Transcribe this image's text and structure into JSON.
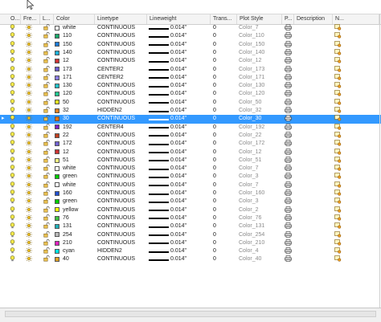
{
  "header": {
    "columns": [
      "O...",
      "Fre...",
      "L...",
      "Color",
      "Linetype",
      "Lineweight",
      "Trans...",
      "Plot Style",
      "P...",
      "Description",
      "N..."
    ]
  },
  "rows": [
    {
      "color_name": "white",
      "color_hex": "#ffffff",
      "linetype": "CONTINUOUS",
      "lineweight": "0.014\"",
      "trans": "0",
      "plot_style": "Color_7",
      "selected": false
    },
    {
      "color_name": "110",
      "color_hex": "#1aa86a",
      "linetype": "CONTINUOUS",
      "lineweight": "0.014\"",
      "trans": "0",
      "plot_style": "Color_110",
      "selected": false
    },
    {
      "color_name": "150",
      "color_hex": "#1a7ad6",
      "linetype": "CONTINUOUS",
      "lineweight": "0.014\"",
      "trans": "0",
      "plot_style": "Color_150",
      "selected": false
    },
    {
      "color_name": "140",
      "color_hex": "#1ab0d8",
      "linetype": "CONTINUOUS",
      "lineweight": "0.014\"",
      "trans": "0",
      "plot_style": "Color_140",
      "selected": false
    },
    {
      "color_name": "12",
      "color_hex": "#cc3333",
      "linetype": "CONTINUOUS",
      "lineweight": "0.014\"",
      "trans": "0",
      "plot_style": "Color_12",
      "selected": false
    },
    {
      "color_name": "173",
      "color_hex": "#6a5acd",
      "linetype": "CENTER2",
      "lineweight": "0.014\"",
      "trans": "0",
      "plot_style": "Color_173",
      "selected": false
    },
    {
      "color_name": "171",
      "color_hex": "#8a7ae0",
      "linetype": "CENTER2",
      "lineweight": "0.014\"",
      "trans": "0",
      "plot_style": "Color_171",
      "selected": false
    },
    {
      "color_name": "130",
      "color_hex": "#20c0c8",
      "linetype": "CONTINUOUS",
      "lineweight": "0.014\"",
      "trans": "0",
      "plot_style": "Color_130",
      "selected": false
    },
    {
      "color_name": "120",
      "color_hex": "#20c890",
      "linetype": "CONTINUOUS",
      "lineweight": "0.014\"",
      "trans": "0",
      "plot_style": "Color_120",
      "selected": false
    },
    {
      "color_name": "50",
      "color_hex": "#e0e020",
      "linetype": "CONTINUOUS",
      "lineweight": "0.014\"",
      "trans": "0",
      "plot_style": "Color_50",
      "selected": false
    },
    {
      "color_name": "32",
      "color_hex": "#e08020",
      "linetype": "HIDDEN2",
      "lineweight": "0.014\"",
      "trans": "0",
      "plot_style": "Color_32",
      "selected": false
    },
    {
      "color_name": "30",
      "color_hex": "#e07010",
      "linetype": "CONTINUOUS",
      "lineweight": "0.014\"",
      "trans": "0",
      "plot_style": "Color_30",
      "selected": true
    },
    {
      "color_name": "192",
      "color_hex": "#8020c0",
      "linetype": "CENTER4",
      "lineweight": "0.014\"",
      "trans": "0",
      "plot_style": "Color_192",
      "selected": false
    },
    {
      "color_name": "22",
      "color_hex": "#c04020",
      "linetype": "CONTINUOUS",
      "lineweight": "0.014\"",
      "trans": "0",
      "plot_style": "Color_22",
      "selected": false
    },
    {
      "color_name": "172",
      "color_hex": "#7060d0",
      "linetype": "CONTINUOUS",
      "lineweight": "0.014\"",
      "trans": "0",
      "plot_style": "Color_172",
      "selected": false
    },
    {
      "color_name": "12",
      "color_hex": "#cc3333",
      "linetype": "CONTINUOUS",
      "lineweight": "0.014\"",
      "trans": "0",
      "plot_style": "Color_12",
      "selected": false
    },
    {
      "color_name": "51",
      "color_hex": "#f0f080",
      "linetype": "CONTINUOUS",
      "lineweight": "0.014\"",
      "trans": "0",
      "plot_style": "Color_51",
      "selected": false
    },
    {
      "color_name": "white",
      "color_hex": "#ffffff",
      "linetype": "CONTINUOUS",
      "lineweight": "0.014\"",
      "trans": "0",
      "plot_style": "Color_7",
      "selected": false
    },
    {
      "color_name": "green",
      "color_hex": "#00cc00",
      "linetype": "CONTINUOUS",
      "lineweight": "0.014\"",
      "trans": "0",
      "plot_style": "Color_3",
      "selected": false
    },
    {
      "color_name": "white",
      "color_hex": "#ffffff",
      "linetype": "CONTINUOUS",
      "lineweight": "0.014\"",
      "trans": "0",
      "plot_style": "Color_7",
      "selected": false
    },
    {
      "color_name": "160",
      "color_hex": "#2050d0",
      "linetype": "CONTINUOUS",
      "lineweight": "0.014\"",
      "trans": "0",
      "plot_style": "Color_160",
      "selected": false
    },
    {
      "color_name": "green",
      "color_hex": "#00cc00",
      "linetype": "CONTINUOUS",
      "lineweight": "0.014\"",
      "trans": "0",
      "plot_style": "Color_3",
      "selected": false
    },
    {
      "color_name": "yellow",
      "color_hex": "#ffff00",
      "linetype": "CONTINUOUS",
      "lineweight": "0.014\"",
      "trans": "0",
      "plot_style": "Color_2",
      "selected": false
    },
    {
      "color_name": "76",
      "color_hex": "#40c040",
      "linetype": "CONTINUOUS",
      "lineweight": "0.014\"",
      "trans": "0",
      "plot_style": "Color_76",
      "selected": false
    },
    {
      "color_name": "131",
      "color_hex": "#20b0b8",
      "linetype": "CONTINUOUS",
      "lineweight": "0.014\"",
      "trans": "0",
      "plot_style": "Color_131",
      "selected": false
    },
    {
      "color_name": "254",
      "color_hex": "#b8b8b8",
      "linetype": "CONTINUOUS",
      "lineweight": "0.014\"",
      "trans": "0",
      "plot_style": "Color_254",
      "selected": false
    },
    {
      "color_name": "210",
      "color_hex": "#e020c0",
      "linetype": "CONTINUOUS",
      "lineweight": "0.014\"",
      "trans": "0",
      "plot_style": "Color_210",
      "selected": false
    },
    {
      "color_name": "cyan",
      "color_hex": "#00e0e0",
      "linetype": "HIDDEN2",
      "lineweight": "0.014\"",
      "trans": "0",
      "plot_style": "Color_4",
      "selected": false
    },
    {
      "color_name": "40",
      "color_hex": "#e0a020",
      "linetype": "CONTINUOUS",
      "lineweight": "0.014\"",
      "trans": "0",
      "plot_style": "Color_40",
      "selected": false
    }
  ]
}
